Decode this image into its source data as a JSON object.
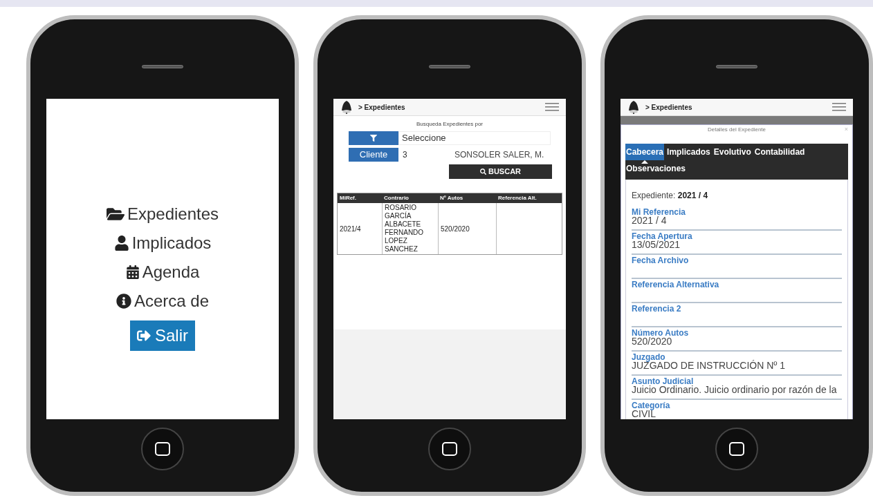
{
  "phones": [
    {
      "kind": "menu",
      "menu": [
        {
          "kind": "folder",
          "label": "Expedientes"
        },
        {
          "kind": "user",
          "label": "Implicados"
        },
        {
          "kind": "calendar",
          "label": "Agenda"
        },
        {
          "kind": "info",
          "label": "Acerca de"
        }
      ],
      "exit_button": "Salir"
    },
    {
      "kind": "search",
      "breadcrumb": "> Expedientes",
      "search_title": "Busqueda Expedientes por",
      "filter_select": {
        "value": "Seleccione"
      },
      "client": {
        "label": "Cliente",
        "code": "3",
        "name": "SONSOLER SALER, M."
      },
      "search_button": "BUSCAR",
      "table": {
        "columns": [
          "MiRef.",
          "Contrario",
          "Nº Autos",
          "Referencia Alt."
        ],
        "rows": [
          {
            "miref": "2021/4",
            "contrario": "ROSARIO GARCÍA ALBACETE FERNANDO LOPEZ SANCHEZ",
            "autos": "520/2020"
          }
        ]
      }
    },
    {
      "kind": "details",
      "breadcrumb": "> Expedientes",
      "modal": {
        "title": "Detalles del Expediente",
        "close": "×",
        "tabs": [
          {
            "label": "Cabecera",
            "selected": true
          },
          {
            "label": "Implicados",
            "selected": false
          },
          {
            "label": "Evolutivo",
            "selected": false
          },
          {
            "label": "Contabilidad",
            "selected": false
          },
          {
            "label": "Observaciones",
            "selected": false
          }
        ],
        "expediente_label": "Expediente:",
        "expediente_value": "2021 / 4",
        "fields": [
          {
            "label": "Mi Referencia",
            "value": "2021 / 4"
          },
          {
            "label": "Fecha Apertura",
            "value": "13/05/2021"
          },
          {
            "label": "Fecha Archivo"
          },
          {
            "label": "Referencia Alternativa"
          },
          {
            "label": "Referencia 2"
          },
          {
            "label": "Número Autos",
            "value": "520/2020"
          },
          {
            "label": "Juzgado",
            "value": "JUZGADO DE INSTRUCCIÓN Nº 1"
          },
          {
            "label": "Asunto Judicial",
            "value": "Juicio Ordinario. Juicio ordinario por razón de la"
          },
          {
            "label": "Categoría",
            "value": "CIVIL"
          }
        ]
      }
    }
  ]
}
